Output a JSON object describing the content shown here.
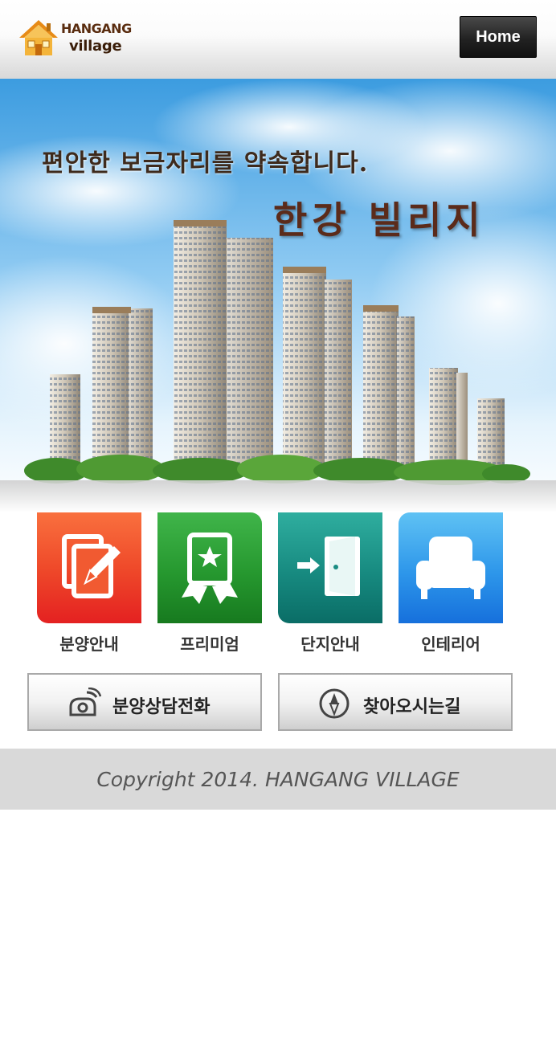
{
  "header": {
    "logo_line1": "HANGANG",
    "logo_line2": "village",
    "home_label": "Home"
  },
  "banner": {
    "slogan": "편안한 보금자리를 약속합니다.",
    "brand": "한강 빌리지"
  },
  "menu": [
    {
      "label": "분양안내",
      "icon": "document-pen-icon",
      "color": "#e83a28"
    },
    {
      "label": "프리미엄",
      "icon": "ribbon-star-icon",
      "color": "#23902c"
    },
    {
      "label": "단지안내",
      "icon": "door-enter-icon",
      "color": "#138378"
    },
    {
      "label": "인테리어",
      "icon": "armchair-icon",
      "color": "#2a8ce8"
    }
  ],
  "actions": {
    "call_label": "분양상담전화",
    "call_icon": "phone-icon",
    "directions_label": "찾아오시는길",
    "directions_icon": "compass-icon"
  },
  "footer": {
    "copyright": "Copyright 2014. HANGANG VILLAGE"
  }
}
